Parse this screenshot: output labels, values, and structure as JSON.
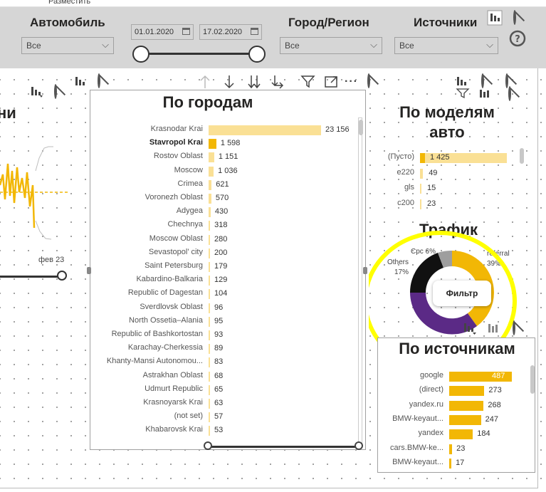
{
  "menu": {
    "arrange_label": "Разместить"
  },
  "filters": {
    "car": {
      "label": "Автомобиль",
      "value": "Все"
    },
    "date_from": "01.01.2020",
    "date_to": "17.02.2020",
    "city": {
      "label": "Город/Регион",
      "value": "Все"
    },
    "sources": {
      "label": "Источники",
      "value": "Все"
    }
  },
  "left_visual": {
    "title_fragment": "ни",
    "axis_label": "фев 23"
  },
  "cities": {
    "title": "По городам",
    "max": 23156,
    "rows": [
      {
        "label": "Krasnodar Krai",
        "value": 23156,
        "display": "23 156",
        "bold": false
      },
      {
        "label": "Stavropol Krai",
        "value": 1598,
        "display": "1 598",
        "bold": true
      },
      {
        "label": "Rostov Oblast",
        "value": 1151,
        "display": "1 151",
        "bold": false
      },
      {
        "label": "Moscow",
        "value": 1036,
        "display": "1 036",
        "bold": false
      },
      {
        "label": "Crimea",
        "value": 621,
        "display": "621",
        "bold": false
      },
      {
        "label": "Voronezh Oblast",
        "value": 570,
        "display": "570",
        "bold": false
      },
      {
        "label": "Adygea",
        "value": 430,
        "display": "430",
        "bold": false
      },
      {
        "label": "Chechnya",
        "value": 318,
        "display": "318",
        "bold": false
      },
      {
        "label": "Moscow Oblast",
        "value": 280,
        "display": "280",
        "bold": false
      },
      {
        "label": "Sevastopol' city",
        "value": 200,
        "display": "200",
        "bold": false
      },
      {
        "label": "Saint Petersburg",
        "value": 179,
        "display": "179",
        "bold": false
      },
      {
        "label": "Kabardino-Balkaria",
        "value": 129,
        "display": "129",
        "bold": false
      },
      {
        "label": "Republic of Dagestan",
        "value": 104,
        "display": "104",
        "bold": false
      },
      {
        "label": "Sverdlovsk Oblast",
        "value": 96,
        "display": "96",
        "bold": false
      },
      {
        "label": "North Ossetia–Alania",
        "value": 95,
        "display": "95",
        "bold": false
      },
      {
        "label": "Republic of Bashkortostan",
        "value": 93,
        "display": "93",
        "bold": false
      },
      {
        "label": "Karachay-Cherkessia",
        "value": 89,
        "display": "89",
        "bold": false
      },
      {
        "label": "Khanty-Mansi Autonomou...",
        "value": 83,
        "display": "83",
        "bold": false
      },
      {
        "label": "Astrakhan Oblast",
        "value": 68,
        "display": "68",
        "bold": false
      },
      {
        "label": "Udmurt Republic",
        "value": 65,
        "display": "65",
        "bold": false
      },
      {
        "label": "Krasnoyarsk Krai",
        "value": 63,
        "display": "63",
        "bold": false
      },
      {
        "label": "(not set)",
        "value": 57,
        "display": "57",
        "bold": false
      },
      {
        "label": "Khabarovsk Krai",
        "value": 53,
        "display": "53",
        "bold": false
      }
    ]
  },
  "models": {
    "title_line1": "По моделям",
    "title_line2": "авто",
    "max": 1425,
    "rows": [
      {
        "label": "(Пусто)",
        "value": 1425,
        "display": "1 425"
      },
      {
        "label": "e220",
        "value": 49,
        "display": "49"
      },
      {
        "label": "gls",
        "value": 15,
        "display": "15"
      },
      {
        "label": "c200",
        "value": 23,
        "display": "23"
      }
    ]
  },
  "traffic": {
    "title": "Трафик",
    "labels": {
      "cpc": "Cpc 6%",
      "others_name": "Others",
      "others_pct": "17%",
      "referral_name": "referral",
      "referral_pct": "39%"
    },
    "tooltip": "Фильтр"
  },
  "sources": {
    "title": "По источникам",
    "max": 487,
    "rows": [
      {
        "label": "google",
        "value": 487,
        "display": "487"
      },
      {
        "label": "(direct)",
        "value": 273,
        "display": "273"
      },
      {
        "label": "yandex.ru",
        "value": 268,
        "display": "268"
      },
      {
        "label": "BMW-keyaut...",
        "value": 247,
        "display": "247"
      },
      {
        "label": "yandex",
        "value": 184,
        "display": "184"
      },
      {
        "label": "cars.BMW-ke...",
        "value": 23,
        "display": "23"
      },
      {
        "label": "BMW-keyaut...",
        "value": 17,
        "display": "17"
      }
    ]
  },
  "colors": {
    "primary_bar": "#F2B705",
    "light_bar": "#FAE095",
    "highlight": "#FFFF00",
    "donut_orange": "#F2B705",
    "donut_purple": "#5B2A86",
    "donut_black": "#111111",
    "donut_gray": "#9E9E9E"
  },
  "icons": [
    "focus-mode-icon",
    "prohibit-icon",
    "help-icon",
    "drill-up-icon",
    "drill-down-icon",
    "expand-all-icon",
    "expand-next-icon",
    "filter-icon",
    "focus-icon",
    "more-options-icon",
    "calendar-icon",
    "chevron-down-icon"
  ]
}
